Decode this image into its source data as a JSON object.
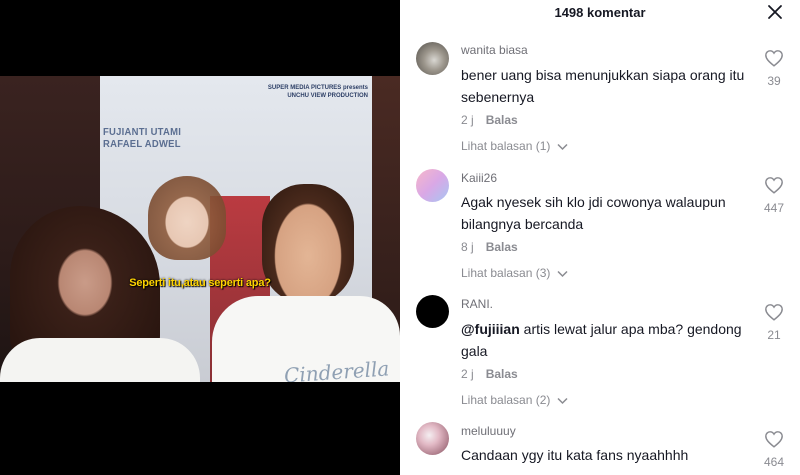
{
  "video": {
    "poster_brand": "SUPER MEDIA PICTURES presents\nUNCHU VIEW PRODUCTION",
    "poster_names": "FUJIANTI UTAMI\nRAFAEL ADWEL",
    "shirt_print": "Cinderella",
    "subtitle": "Seperti itu,atau seperti apa?"
  },
  "panel": {
    "title": "1498 komentar"
  },
  "comments": [
    {
      "author": "wanita biasa",
      "text": "bener uang bisa menunjukkan siapa orang itu sebenernya",
      "time": "2 j",
      "reply_label": "Balas",
      "view_replies": "Lihat balasan (1)",
      "likes": "39"
    },
    {
      "author": "Kaiii26",
      "text": "Agak nyesek sih klo jdi cowonya walaupun bilangnya bercanda",
      "time": "8 j",
      "reply_label": "Balas",
      "view_replies": "Lihat balasan (3)",
      "likes": "447"
    },
    {
      "author": "RANI.",
      "mention": "@fujiiian",
      "text": " artis lewat jalur apa mba? gendong gala",
      "time": "2 j",
      "reply_label": "Balas",
      "view_replies": "Lihat balasan (2)",
      "likes": "21"
    },
    {
      "author": "meluluuuy",
      "text": "Candaan ygy itu kata fans nyaahhhh",
      "likes": "464"
    }
  ],
  "icons": {
    "close": "close-icon",
    "like": "heart-outline-icon",
    "expand": "chevron-down-icon"
  }
}
